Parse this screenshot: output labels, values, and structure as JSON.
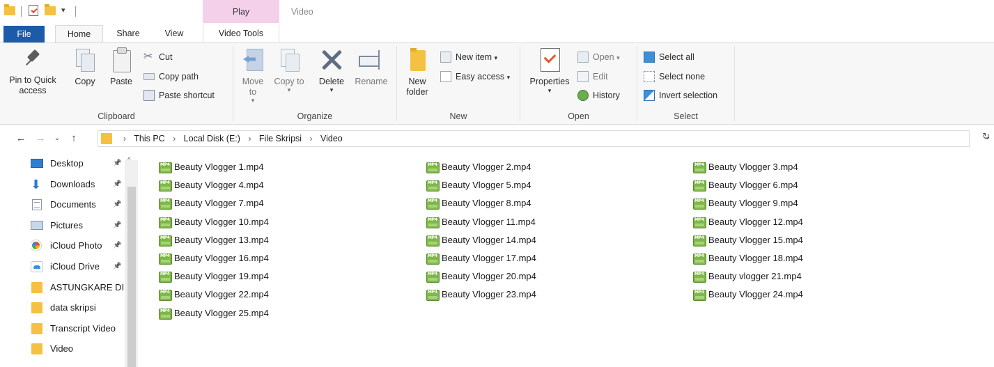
{
  "title_bar": {
    "contextual_tab_label": "Play",
    "window_title": "Video"
  },
  "tabs": {
    "file": "File",
    "home": "Home",
    "share": "Share",
    "view": "View",
    "video_tools": "Video Tools"
  },
  "ribbon": {
    "clipboard": {
      "label": "Clipboard",
      "pin_to_quick_access": "Pin to Quick access",
      "copy": "Copy",
      "paste": "Paste",
      "cut": "Cut",
      "copy_path": "Copy path",
      "paste_shortcut": "Paste shortcut"
    },
    "organize": {
      "label": "Organize",
      "move_to": "Move to",
      "copy_to": "Copy to",
      "delete": "Delete",
      "rename": "Rename"
    },
    "new": {
      "label": "New",
      "new_folder": "New folder",
      "new_item": "New item",
      "easy_access": "Easy access"
    },
    "open": {
      "label": "Open",
      "properties": "Properties",
      "open": "Open",
      "edit": "Edit",
      "history": "History"
    },
    "select": {
      "label": "Select",
      "select_all": "Select all",
      "select_none": "Select none",
      "invert_selection": "Invert selection"
    }
  },
  "address_bar": {
    "breadcrumb": [
      "This PC",
      "Local Disk (E:)",
      "File Skripsi",
      "Video"
    ]
  },
  "nav_pane": {
    "items": [
      {
        "label": "Desktop",
        "icon": "desktop-icon",
        "pinned": true
      },
      {
        "label": "Downloads",
        "icon": "downloads-icon",
        "pinned": true
      },
      {
        "label": "Documents",
        "icon": "documents-icon",
        "pinned": true
      },
      {
        "label": "Pictures",
        "icon": "pictures-icon",
        "pinned": true
      },
      {
        "label": "iCloud Photo",
        "icon": "icloud-photos-icon",
        "pinned": true
      },
      {
        "label": "iCloud Drive",
        "icon": "icloud-drive-icon",
        "pinned": true
      },
      {
        "label": "ASTUNGKARE DI",
        "icon": "folder-icon",
        "pinned": false
      },
      {
        "label": "data skripsi",
        "icon": "folder-icon",
        "pinned": false
      },
      {
        "label": "Transcript Video",
        "icon": "folder-icon",
        "pinned": false
      },
      {
        "label": "Video",
        "icon": "folder-icon",
        "pinned": false
      }
    ]
  },
  "files": [
    "Beauty Vlogger 1.mp4",
    "Beauty Vlogger 2.mp4",
    "Beauty Vlogger 3.mp4",
    "Beauty Vlogger 4.mp4",
    "Beauty Vlogger 5.mp4",
    "Beauty Vlogger 6.mp4",
    "Beauty Vlogger 7.mp4",
    "Beauty Vlogger 8.mp4",
    "Beauty Vlogger 9.mp4",
    "Beauty Vlogger 10.mp4",
    "Beauty Vlogger 11.mp4",
    "Beauty Vlogger 12.mp4",
    "Beauty Vlogger 13.mp4",
    "Beauty Vlogger 14.mp4",
    "Beauty Vlogger 15.mp4",
    "Beauty Vlogger 16.mp4",
    "Beauty Vlogger 17.mp4",
    "Beauty Vlogger 18.mp4",
    "Beauty Vlogger 19.mp4",
    "Beauty Vlogger 20.mp4",
    "Beauty vlogger 21.mp4",
    "Beauty Vlogger 22.mp4",
    "Beauty Vlogger 23.mp4",
    "Beauty Vlogger 24.mp4",
    "Beauty Vlogger 25.mp4"
  ],
  "colors": {
    "file_tab": "#1d5aa8",
    "contextual_tab": "#f5d0ea",
    "folder": "#f5c142",
    "mp4_icon": "#7db946"
  }
}
